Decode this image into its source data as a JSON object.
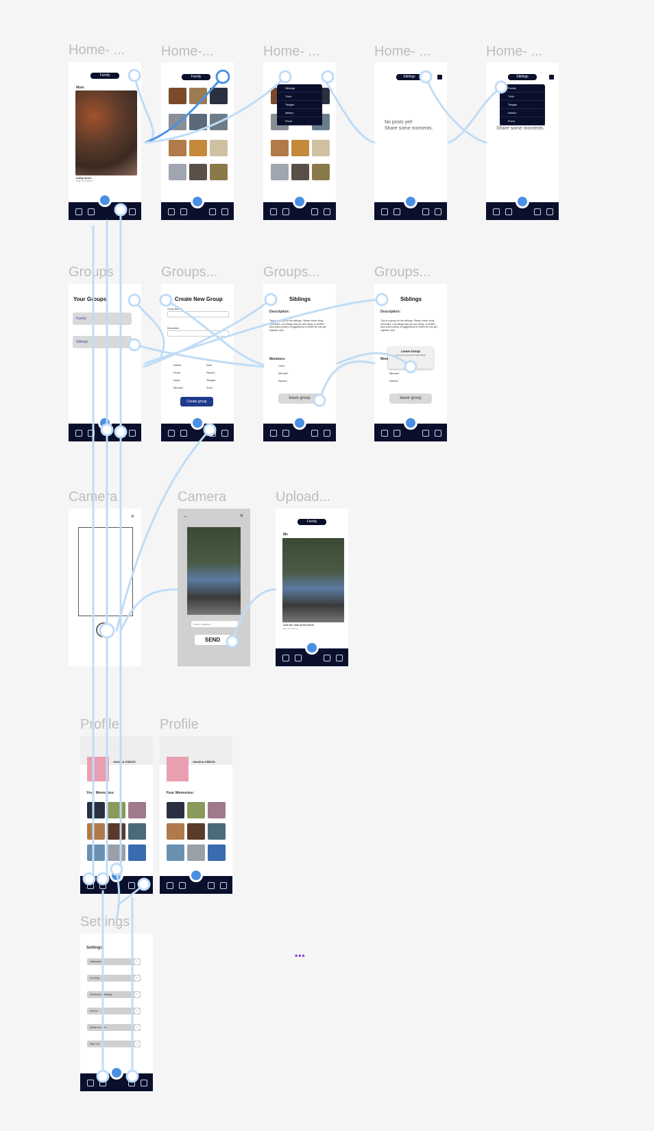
{
  "frames": {
    "home1": {
      "label": "Home- ...",
      "pill": "Family",
      "author": "Mom",
      "caption": "today lunch",
      "time": "May 12 3:00pm"
    },
    "home2": {
      "label": "Home-...",
      "pill": "Family"
    },
    "home3": {
      "label": "Home- ...",
      "dropdown": [
        "Siblings",
        "Trinh",
        "Teagan",
        "Nelson",
        "Fiona"
      ]
    },
    "home4": {
      "label": "Home- ...",
      "pill": "Siblings",
      "empty1": "No posts yet!",
      "empty2": "Share some moments."
    },
    "home5": {
      "label": "Home- ...",
      "pill": "Siblings",
      "dropdown": [
        "Family",
        "Trinh",
        "Teagan",
        "Nelson",
        "Fiona"
      ],
      "empty2": "Share some moments."
    },
    "groups1": {
      "label": "Groups",
      "title": "Your Groups",
      "groups": [
        "Family",
        "Siblings"
      ]
    },
    "groups2": {
      "label": "Groups...",
      "title": "Create New Group",
      "field1": "Group Name *",
      "field2": "Description",
      "members": [
        "Daniel",
        "Noel",
        "Fiona",
        "Rachel",
        "Noah",
        "Teagan",
        "Michael",
        "Trinh"
      ],
      "button": "Create group"
    },
    "groups3": {
      "label": "Groups...",
      "title": "Siblings",
      "desc_label": "Description:",
      "desc": "This is a group for the siblings. Please share funny memories, cool things that you are doing, or perfect Also share points of suggestions of where we can get together next.",
      "members_label": "Members:",
      "members": [
        "Chris",
        "Michael",
        "Rachel"
      ],
      "button": "leave group"
    },
    "groups4": {
      "label": "Groups...",
      "title": "Siblings",
      "desc_label": "Description:",
      "desc": "This is a group for the siblings. Please share funny memories, cool things that you are doing, or perfect Also share points of suggestions of where we can get together next.",
      "members_label": "Mem",
      "members": [
        "Michael",
        "Rachel"
      ],
      "popup_title": "Leave Group",
      "popup_text": "Are you sure you want to leave siblings",
      "button": "leave group"
    },
    "camera1": {
      "label": "Camera"
    },
    "camera2": {
      "label": "Camera",
      "caption_placeholder": "Add a caption...",
      "send": "SEND"
    },
    "upload": {
      "label": "Upload...",
      "pill": "Family",
      "author": "Me",
      "caption": "cool car I saw on the street",
      "time": "May 15 4:00 pm"
    },
    "profile1": {
      "label": "Profile",
      "name": "Jessica Aldrich",
      "memories": "Your Memories:"
    },
    "profile2": {
      "label": "Profile",
      "name": "Jessica Aldrich",
      "memories": "Your Memories:"
    },
    "settings": {
      "label": "Settings",
      "title": "Settings",
      "rows": [
        "Notifications",
        "Our Help",
        "General Info Settings",
        "Archive",
        "Delete Account",
        "Sign Out"
      ]
    }
  },
  "colors": {
    "navy": "#0a0f2c",
    "accent": "#4a90e2",
    "flow": "#bfdcf7",
    "flowActive": "#4a90e2"
  },
  "icons": [
    "home-icon",
    "groups-icon",
    "camera-icon",
    "profile-icon",
    "settings-icon",
    "close-icon",
    "back-icon",
    "grid-icon",
    "chevron-right-icon"
  ]
}
